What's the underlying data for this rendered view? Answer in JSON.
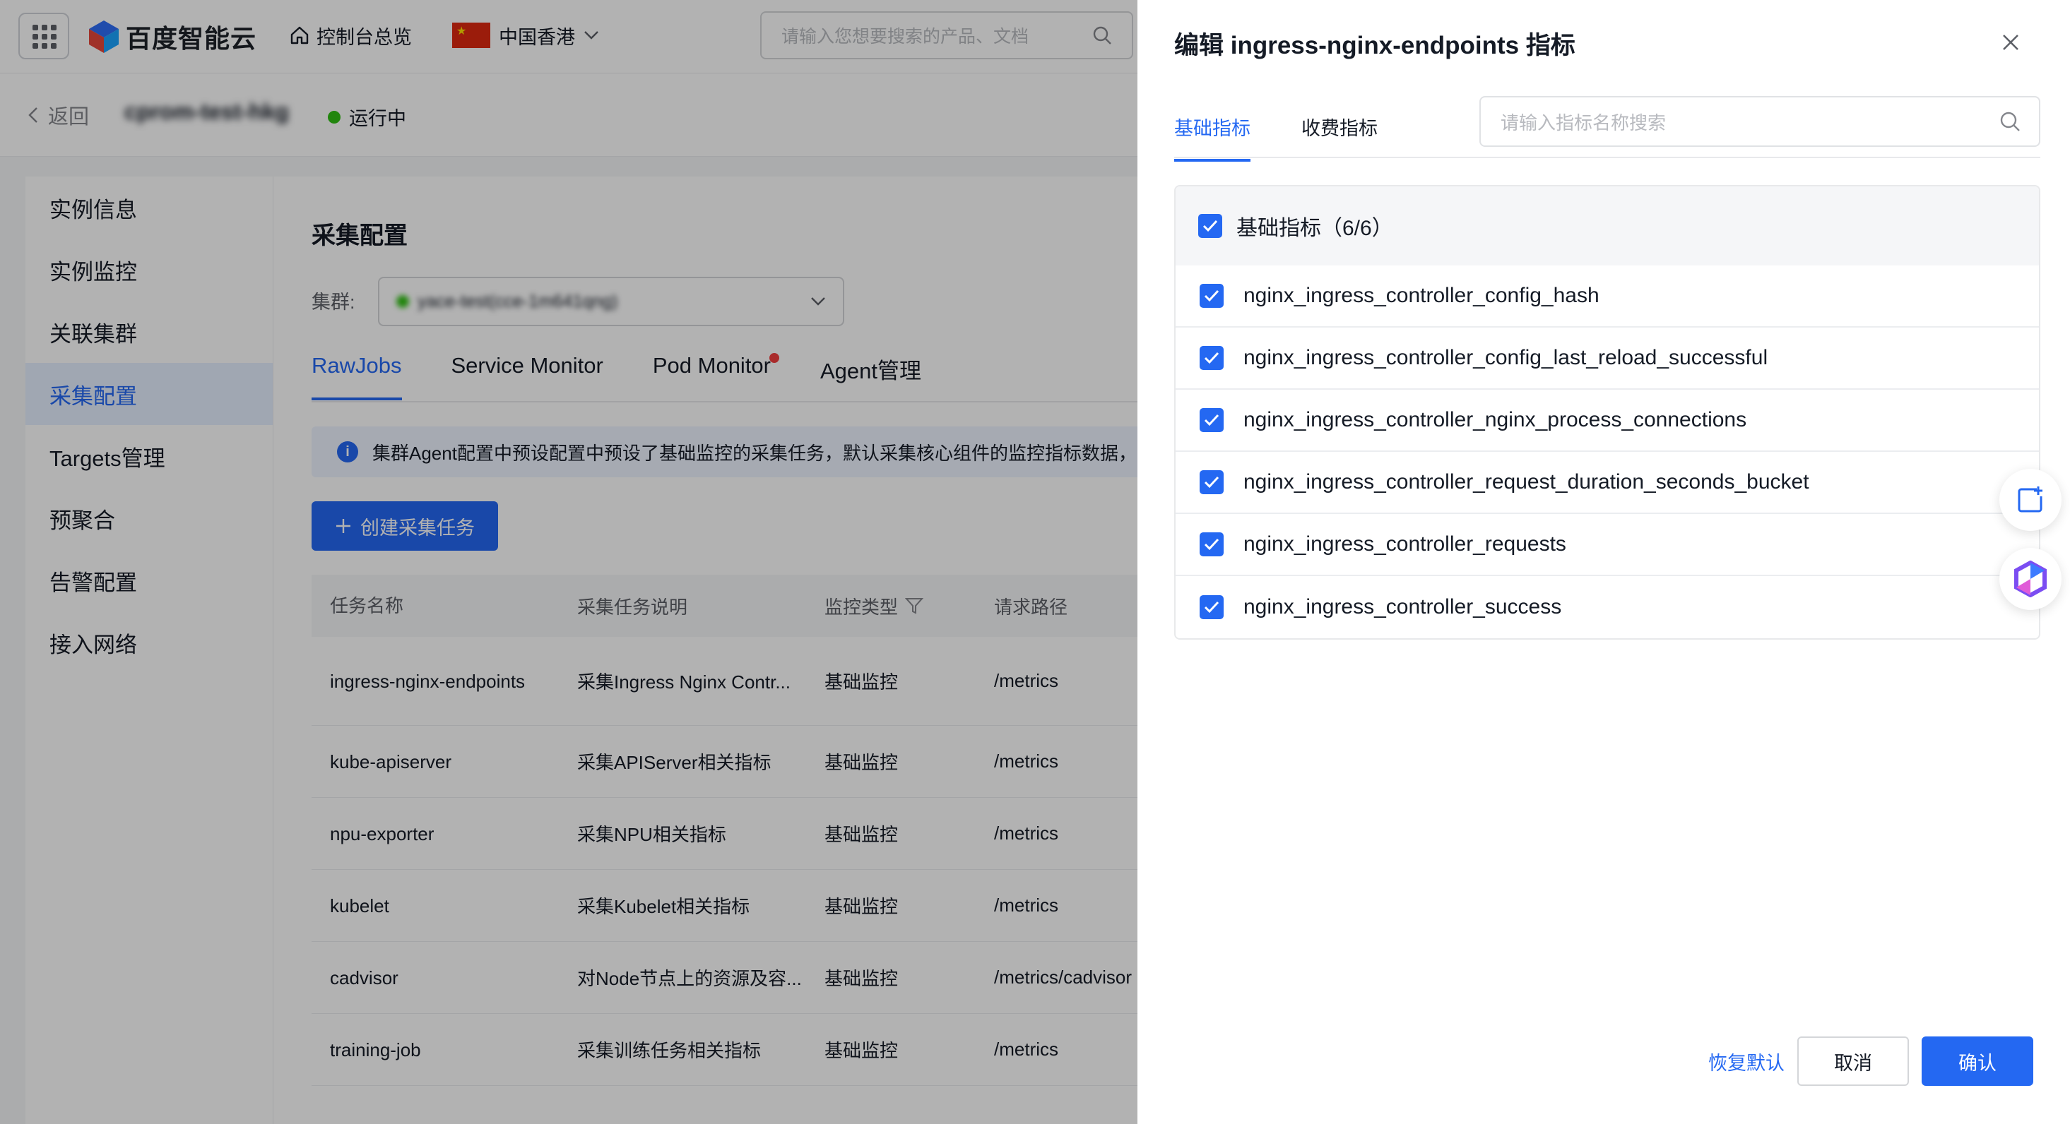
{
  "topbar": {
    "logo_text": "百度智能云",
    "console_label": "控制台总览",
    "region_label": "中国香港",
    "search_placeholder": "请输入您想要搜索的产品、文档"
  },
  "subhead": {
    "back_label": "返回",
    "instance_name": "cprom-test-hkg",
    "status_label": "运行中"
  },
  "sidebar": {
    "items": [
      {
        "label": "实例信息"
      },
      {
        "label": "实例监控"
      },
      {
        "label": "关联集群"
      },
      {
        "label": "采集配置"
      },
      {
        "label": "Targets管理"
      },
      {
        "label": "预聚合"
      },
      {
        "label": "告警配置"
      },
      {
        "label": "接入网络"
      }
    ]
  },
  "main": {
    "title": "采集配置",
    "cluster_label": "集群:",
    "cluster_value": "yace-test(cce-1m641qng)",
    "tabs": [
      {
        "label": "RawJobs"
      },
      {
        "label": "Service Monitor"
      },
      {
        "label": "Pod Monitor"
      },
      {
        "label": "Agent管理"
      }
    ],
    "notice": "集群Agent配置中预设配置中预设了基础监控的采集任务，默认采集核心组件的监控指标数据，",
    "create_button": "创建采集任务",
    "table": {
      "headers": [
        "任务名称",
        "采集任务说明",
        "监控类型",
        "请求路径"
      ],
      "rows": [
        {
          "name": "ingress-nginx-endpoints",
          "desc": "采集Ingress Nginx Contr...",
          "type": "基础监控",
          "path": "/metrics"
        },
        {
          "name": "kube-apiserver",
          "desc": "采集APIServer相关指标",
          "type": "基础监控",
          "path": "/metrics"
        },
        {
          "name": "npu-exporter",
          "desc": "采集NPU相关指标",
          "type": "基础监控",
          "path": "/metrics"
        },
        {
          "name": "kubelet",
          "desc": "采集Kubelet相关指标",
          "type": "基础监控",
          "path": "/metrics"
        },
        {
          "name": "cadvisor",
          "desc": "对Node节点上的资源及容...",
          "type": "基础监控",
          "path": "/metrics/cadvisor"
        },
        {
          "name": "training-job",
          "desc": "采集训练任务相关指标",
          "type": "基础监控",
          "path": "/metrics"
        }
      ]
    }
  },
  "drawer": {
    "title": "编辑 ingress-nginx-endpoints 指标",
    "tabs": [
      {
        "label": "基础指标"
      },
      {
        "label": "收费指标"
      }
    ],
    "search_placeholder": "请输入指标名称搜索",
    "group_label": "基础指标（6/6）",
    "metrics": [
      "nginx_ingress_controller_config_hash",
      "nginx_ingress_controller_config_last_reload_successful",
      "nginx_ingress_controller_nginx_process_connections",
      "nginx_ingress_controller_request_duration_seconds_bucket",
      "nginx_ingress_controller_requests",
      "nginx_ingress_controller_success"
    ],
    "reset_label": "恢复默认",
    "cancel_label": "取消",
    "confirm_label": "确认"
  },
  "colors": {
    "primary": "#2468f2",
    "running": "#30bf13",
    "flag_red": "#de2910"
  }
}
